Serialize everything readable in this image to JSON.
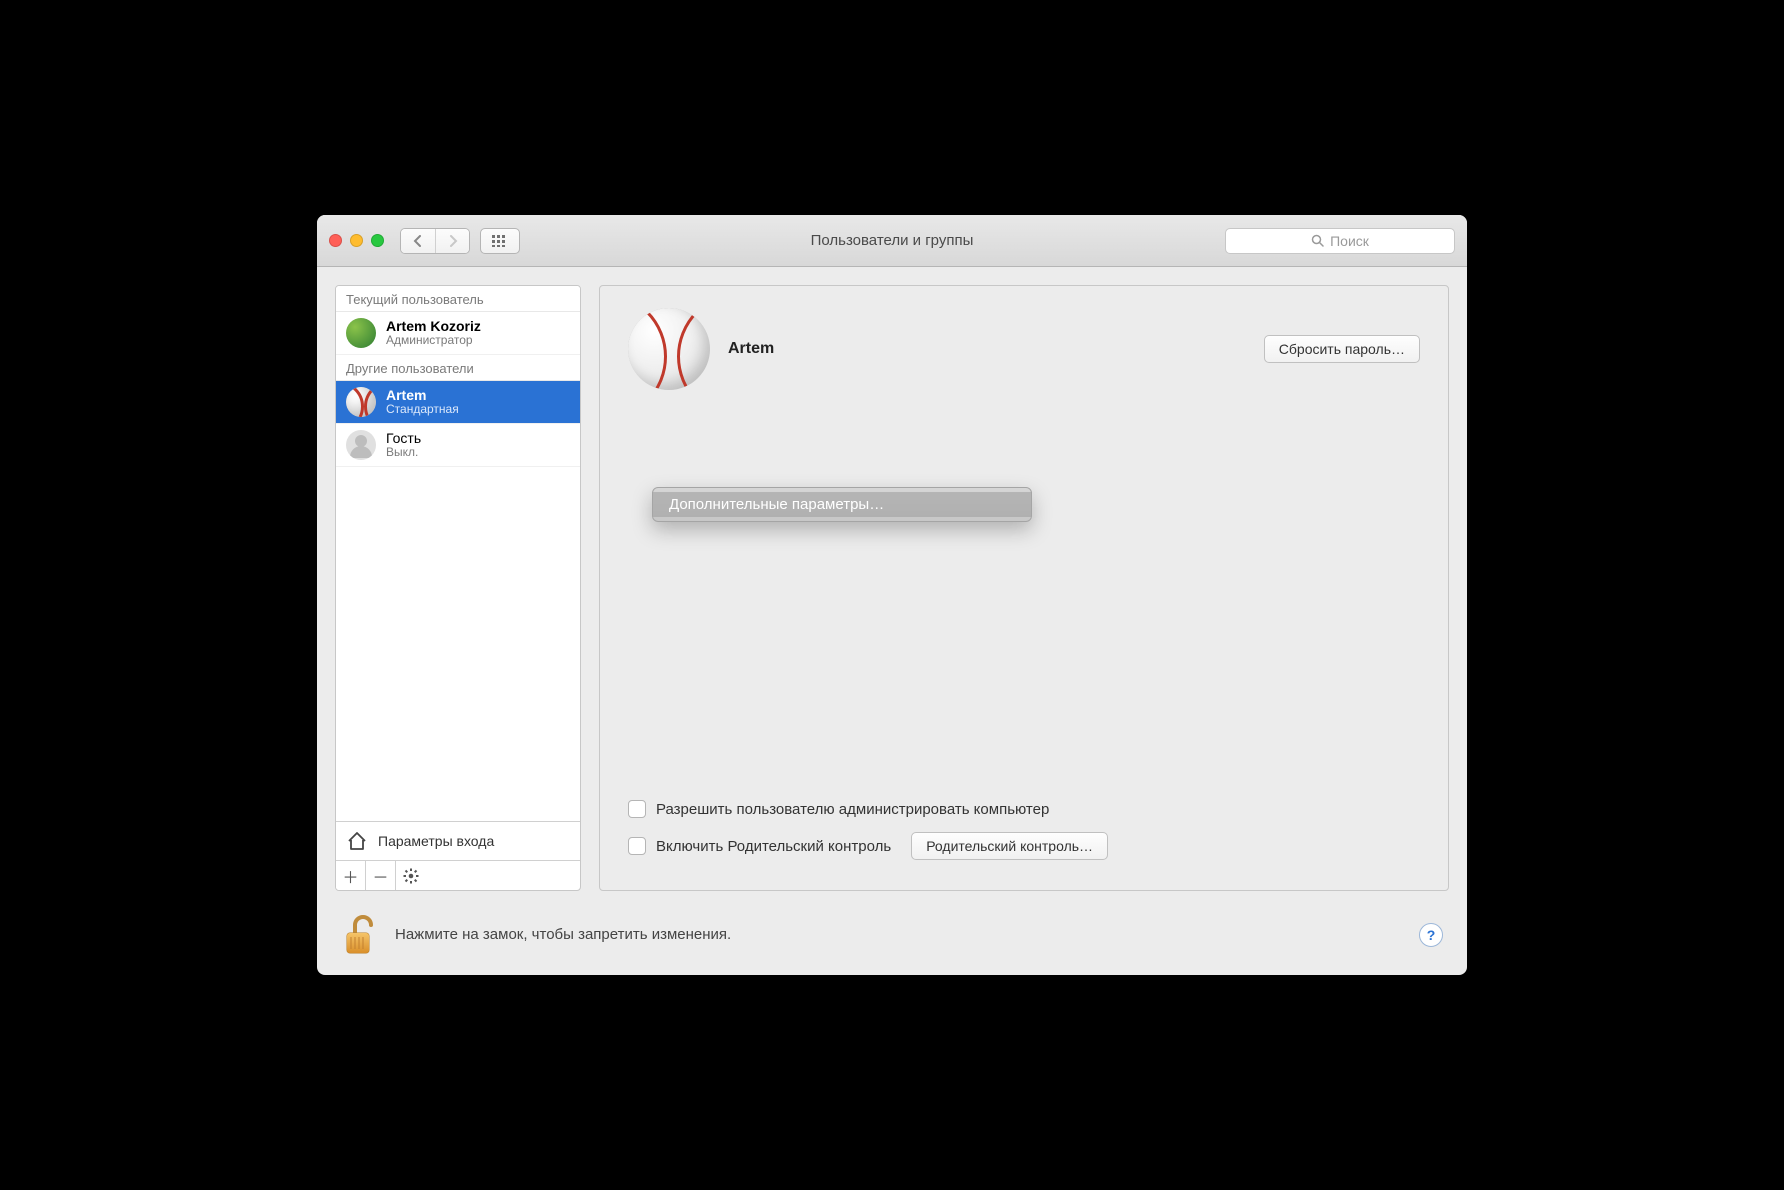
{
  "window": {
    "title": "Пользователи и группы",
    "search_placeholder": "Поиск"
  },
  "sidebar": {
    "current_label": "Текущий пользователь",
    "others_label": "Другие пользователи",
    "current": {
      "name": "Artem Kozoriz",
      "role": "Администратор"
    },
    "users": [
      {
        "name": "Artem",
        "role": "Стандартная",
        "selected": true
      },
      {
        "name": "Гость",
        "role": "Выкл.",
        "selected": false
      }
    ],
    "login_options": "Параметры входа"
  },
  "main": {
    "username": "Artem",
    "reset_password": "Сбросить пароль…",
    "allow_admin": "Разрешить пользователю администрировать компьютер",
    "enable_parental": "Включить Родительский контроль",
    "parental_button": "Родительский контроль…"
  },
  "context_menu": {
    "item": "Дополнительные параметры…"
  },
  "footer": {
    "text": "Нажмите на замок, чтобы запретить изменения.",
    "help": "?"
  }
}
